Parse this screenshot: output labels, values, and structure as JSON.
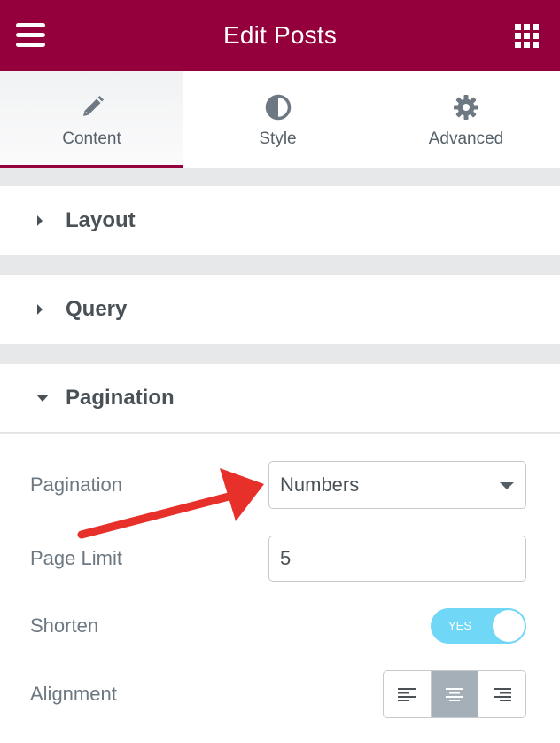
{
  "header": {
    "title": "Edit Posts"
  },
  "tabs": [
    {
      "label": "Content",
      "icon": "pencil-icon",
      "active": true
    },
    {
      "label": "Style",
      "icon": "half-circle-icon",
      "active": false
    },
    {
      "label": "Advanced",
      "icon": "gear-icon",
      "active": false
    }
  ],
  "sections": {
    "layout": {
      "title": "Layout",
      "expanded": false
    },
    "query": {
      "title": "Query",
      "expanded": false
    },
    "pagination": {
      "title": "Pagination",
      "expanded": true
    }
  },
  "fields": {
    "pagination": {
      "label": "Pagination",
      "value": "Numbers"
    },
    "page_limit": {
      "label": "Page Limit",
      "value": "5"
    },
    "shorten": {
      "label": "Shorten",
      "toggle_text": "YES",
      "on": true
    },
    "alignment": {
      "label": "Alignment",
      "options": [
        "left",
        "center",
        "right"
      ],
      "selected": "center"
    }
  },
  "colors": {
    "brand": "#93003c",
    "toggle_on": "#71d7f7",
    "annotation_arrow": "#e8302b"
  }
}
